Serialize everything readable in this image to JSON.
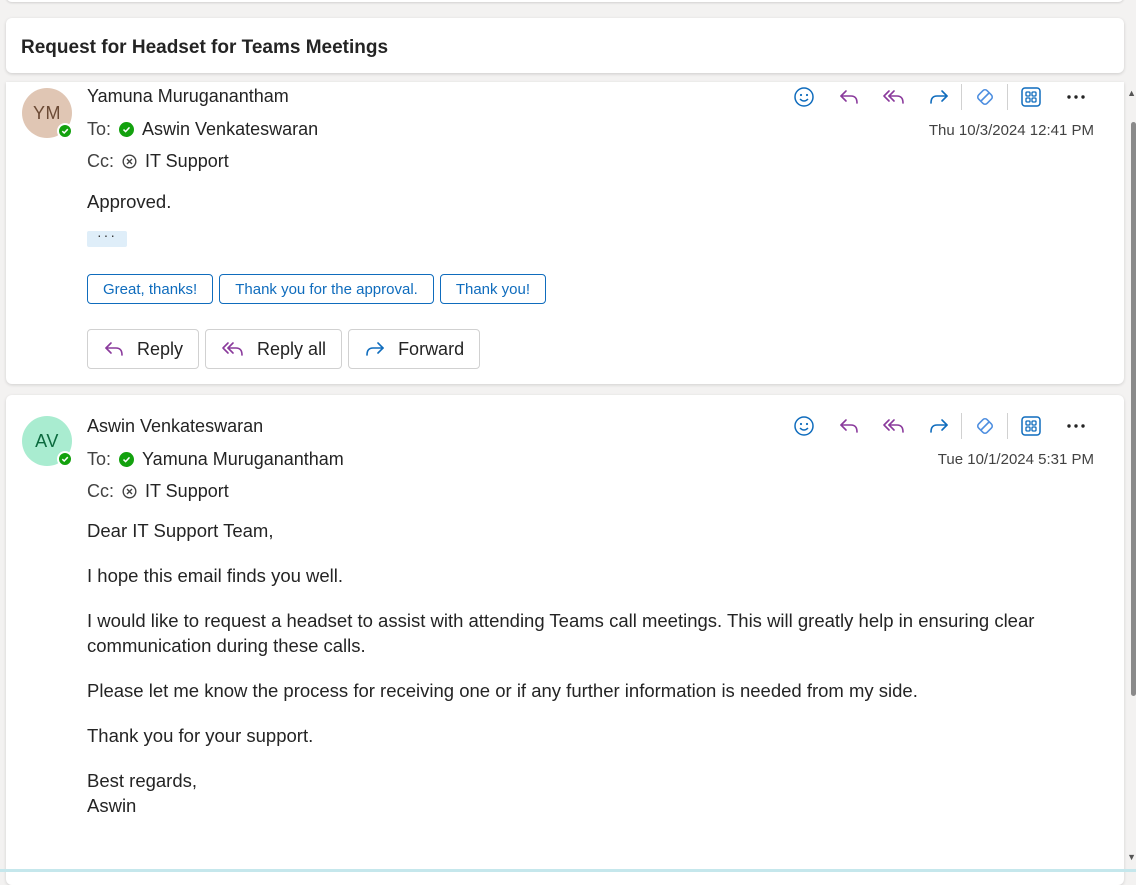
{
  "subject": "Request for Headset for Teams Meetings",
  "colors": {
    "accent_blue": "#0f6cbd",
    "purple_icon": "#8a3a9c",
    "presence_green": "#13a10e"
  },
  "messages": [
    {
      "avatar_initials": "YM",
      "avatar_bg": "#e0c6b4",
      "avatar_fg": "#6b4a35",
      "sender": "Yamuna Muruganantham",
      "to_label": "To:",
      "to_name": "Aswin Venkateswaran",
      "cc_label": "Cc:",
      "cc_name": "IT Support",
      "timestamp": "Thu 10/3/2024 12:41 PM",
      "body": [
        "Approved."
      ],
      "show_trimmed": "···",
      "suggested_replies": [
        "Great, thanks!",
        "Thank you for the approval.",
        "Thank you!"
      ],
      "actions": {
        "reply": "Reply",
        "reply_all": "Reply all",
        "forward": "Forward"
      }
    },
    {
      "avatar_initials": "AV",
      "avatar_bg": "#a9ecd0",
      "avatar_fg": "#0b6a3e",
      "sender": "Aswin Venkateswaran",
      "to_label": "To:",
      "to_name": "Yamuna Muruganantham",
      "cc_label": "Cc:",
      "cc_name": "IT Support",
      "timestamp": "Tue 10/1/2024 5:31 PM",
      "body": [
        "Dear IT Support Team,",
        "I hope this email finds you well.",
        "I would like to request a headset to assist with attending Teams call meetings. This will greatly help in ensuring clear communication during these calls.",
        "Please let me know the process for receiving one or if any further information is needed from my side.",
        "Thank you for your support.",
        "Best regards,",
        "Aswin"
      ]
    }
  ],
  "toolbar_icons": [
    "emoji-icon",
    "reply-icon",
    "reply-all-icon",
    "forward-icon",
    "loop-icon",
    "apps-icon",
    "more-icon"
  ]
}
